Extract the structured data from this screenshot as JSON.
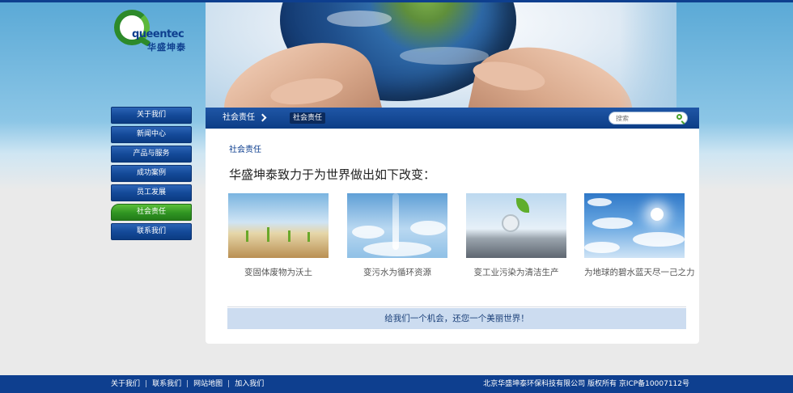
{
  "brand": {
    "logo_word": "queentec",
    "logo_cn": "华盛坤泰"
  },
  "sidebar": {
    "items": [
      {
        "label": "关于我们",
        "active": false
      },
      {
        "label": "新闻中心",
        "active": false
      },
      {
        "label": "产品与服务",
        "active": false
      },
      {
        "label": "成功案例",
        "active": false
      },
      {
        "label": "员工发展",
        "active": false
      },
      {
        "label": "社会责任",
        "active": true
      },
      {
        "label": "联系我们",
        "active": false
      }
    ]
  },
  "header": {
    "crumb": "社会责任",
    "subtab": "社会责任",
    "search_placeholder": "搜索"
  },
  "main": {
    "section_title": "社会责任",
    "headline": "华盛坤泰致力于为世界做出如下改变：",
    "cards": [
      {
        "caption": "变固体废物为沃土",
        "image": "soil-sprouts"
      },
      {
        "caption": "变污水为循环资源",
        "image": "water-sky"
      },
      {
        "caption": "变工业污染为清洁生产",
        "image": "metal-leaf"
      },
      {
        "caption": "为地球的碧水蓝天尽一己之力",
        "image": "blue-sky-sun"
      }
    ],
    "slogan": "给我们一个机会，还您一个美丽世界！"
  },
  "footer": {
    "links": [
      "关于我们",
      "联系我们",
      "网站地图",
      "加入我们"
    ],
    "separator": "|",
    "copyright": "北京华盛坤泰环保科技有限公司 版权所有 京ICP备10007112号"
  },
  "colors": {
    "nav_blue": "#144a99",
    "nav_green": "#2f9422",
    "footer": "#0e3f8f",
    "slogan_bg": "#ccdcf0"
  }
}
